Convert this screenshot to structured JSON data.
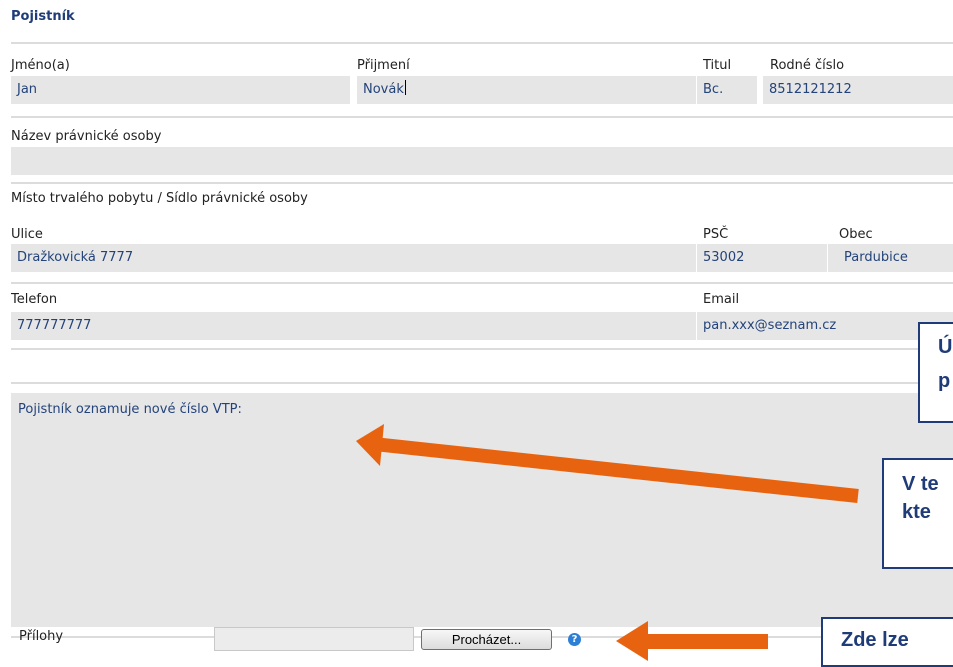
{
  "section": {
    "title": "Pojistník"
  },
  "person": {
    "first_name_label": "Jméno(a)",
    "first_name": "Jan",
    "last_name_label": "Přijmení",
    "last_name": "Novák",
    "title_label": "Titul",
    "title": "Bc.",
    "birth_no_label": "Rodné číslo",
    "birth_no": "8512121212"
  },
  "company": {
    "name_label": "Název právnické osoby",
    "name": ""
  },
  "address": {
    "heading": "Místo trvalého pobytu / Sídlo právnické osoby",
    "street_label": "Ulice",
    "street": "Dražkovická 7777",
    "zip_label": "PSČ",
    "zip": "53002",
    "city_label": "Obec",
    "city": "Pardubice"
  },
  "contact": {
    "phone_label": "Telefon",
    "phone": "777777777",
    "email_label": "Email",
    "email": "pan.xxx@seznam.cz"
  },
  "message": {
    "text": "Pojistník oznamuje nové číslo VTP:"
  },
  "attachments": {
    "label": "Přílohy",
    "browse_label": "Procházet...",
    "help": "?"
  },
  "annotations": {
    "box1_line1": "Ú",
    "box1_line2": "p",
    "box2_line1": "V te",
    "box2_line2": "kte",
    "box3": "Zde lze"
  },
  "colors": {
    "arrow": "#e8630f",
    "heading": "#1f3c78",
    "field_bg": "#e6e6e6",
    "field_text": "#24437a"
  }
}
